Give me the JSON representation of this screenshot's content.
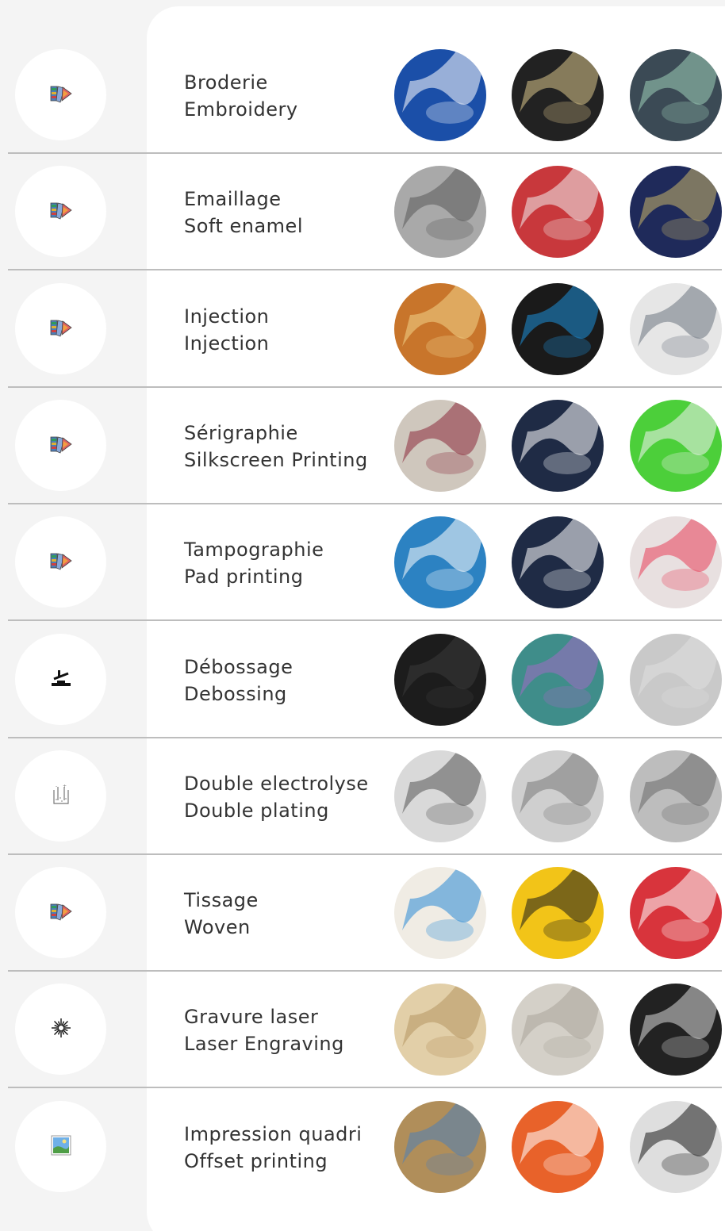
{
  "techniques": [
    {
      "fr": "Broderie",
      "en": "Embroidery",
      "icon": "color-swatch-icon",
      "samples": [
        {
          "bg": "#1b4fa8",
          "fg": "#ffffff"
        },
        {
          "bg": "#222222",
          "fg": "#d9c48a"
        },
        {
          "bg": "#3b4a55",
          "fg": "#9fd0b8"
        }
      ]
    },
    {
      "fr": "Emaillage",
      "en": "Soft enamel",
      "icon": "color-swatch-icon",
      "samples": [
        {
          "bg": "#a9a9a9",
          "fg": "#5a5a5a"
        },
        {
          "bg": "#c8383c",
          "fg": "#f1f1f1"
        },
        {
          "bg": "#1f2a5a",
          "fg": "#c9b56a"
        }
      ]
    },
    {
      "fr": "Injection",
      "en": "Injection",
      "icon": "color-swatch-icon",
      "samples": [
        {
          "bg": "#c8752b",
          "fg": "#f2d38a"
        },
        {
          "bg": "#1a1a1a",
          "fg": "#1e8fd8"
        },
        {
          "bg": "#e6e6e6",
          "fg": "#6c7480"
        }
      ]
    },
    {
      "fr": "Sérigraphie",
      "en": "Silkscreen Printing",
      "icon": "color-swatch-icon",
      "samples": [
        {
          "bg": "#cfc7bd",
          "fg": "#8c2a3c"
        },
        {
          "bg": "#1f2b45",
          "fg": "#ffffff"
        },
        {
          "bg": "#4ccf3a",
          "fg": "#f2f2f2"
        }
      ]
    },
    {
      "fr": "Tampographie",
      "en": "Pad printing",
      "icon": "color-swatch-icon",
      "samples": [
        {
          "bg": "#2c82c2",
          "fg": "#ffffff"
        },
        {
          "bg": "#1f2b45",
          "fg": "#ffffff"
        },
        {
          "bg": "#e8e0e0",
          "fg": "#e8405a"
        }
      ]
    },
    {
      "fr": "Débossage",
      "en": "Debossing",
      "icon": "debossing-press-icon",
      "samples": [
        {
          "bg": "#1c1c1c",
          "fg": "#3a3a3a"
        },
        {
          "bg": "#3f8d8a",
          "fg": "#a36bc4"
        },
        {
          "bg": "#c9c9c9",
          "fg": "#dedede"
        }
      ]
    },
    {
      "fr": "Double electrolyse",
      "en": "Double plating",
      "icon": "electrolysis-beaker-icon",
      "samples": [
        {
          "bg": "#d9d9d9",
          "fg": "#555555"
        },
        {
          "bg": "#cfcfcf",
          "fg": "#7a7a7a"
        },
        {
          "bg": "#bdbdbd",
          "fg": "#6a6a6a"
        }
      ]
    },
    {
      "fr": "Tissage",
      "en": "Woven",
      "icon": "color-swatch-icon",
      "samples": [
        {
          "bg": "#f0ece4",
          "fg": "#2a8ad6"
        },
        {
          "bg": "#f2c418",
          "fg": "#1b1b1b"
        },
        {
          "bg": "#d8343c",
          "fg": "#ffffff"
        }
      ]
    },
    {
      "fr": "Gravure laser",
      "en": "Laser Engraving",
      "icon": "laser-burst-icon",
      "samples": [
        {
          "bg": "#e2cfa8",
          "fg": "#b59660"
        },
        {
          "bg": "#d4d0c8",
          "fg": "#a9a49a"
        },
        {
          "bg": "#222222",
          "fg": "#d9d9d9"
        }
      ]
    },
    {
      "fr": "Impression quadri",
      "en": "Offset printing",
      "icon": "photo-print-icon",
      "samples": [
        {
          "bg": "#b08e5a",
          "fg": "#4f7fb8"
        },
        {
          "bg": "#e8622a",
          "fg": "#ffffff"
        },
        {
          "bg": "#dedede",
          "fg": "#1b1b1b"
        }
      ]
    }
  ]
}
